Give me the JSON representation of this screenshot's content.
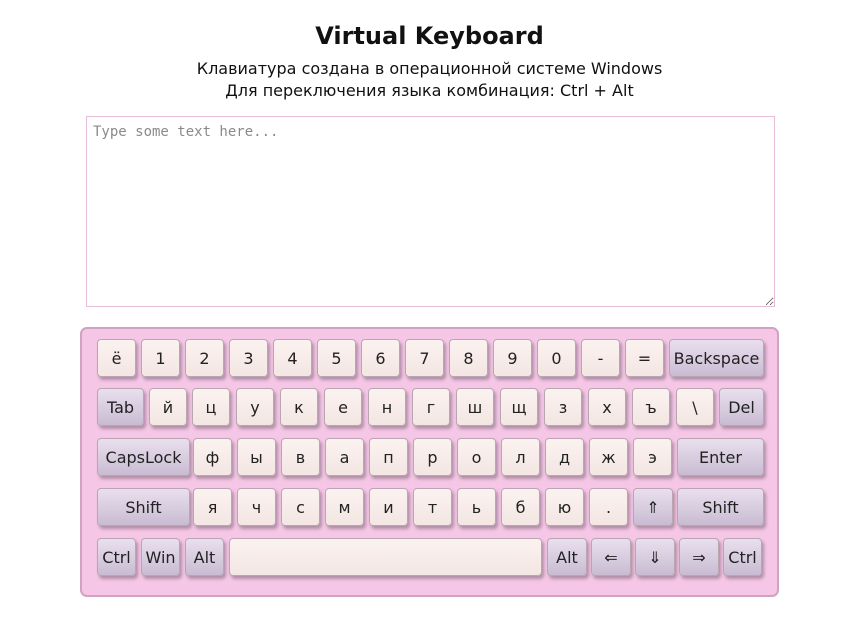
{
  "header": {
    "title": "Virtual Keyboard",
    "line1": "Клавиатура создана в операционной системе Windows",
    "line2": "Для переключения языка комбинация: Ctrl + Alt"
  },
  "textarea": {
    "placeholder": "Type some text here..."
  },
  "keyboard": {
    "rows": [
      [
        {
          "label": "ё",
          "name": "key-yo"
        },
        {
          "label": "1",
          "name": "key-1"
        },
        {
          "label": "2",
          "name": "key-2"
        },
        {
          "label": "3",
          "name": "key-3"
        },
        {
          "label": "4",
          "name": "key-4"
        },
        {
          "label": "5",
          "name": "key-5"
        },
        {
          "label": "6",
          "name": "key-6"
        },
        {
          "label": "7",
          "name": "key-7"
        },
        {
          "label": "8",
          "name": "key-8"
        },
        {
          "label": "9",
          "name": "key-9"
        },
        {
          "label": "0",
          "name": "key-0"
        },
        {
          "label": "-",
          "name": "key-minus"
        },
        {
          "label": "=",
          "name": "key-equals"
        },
        {
          "label": "Backspace",
          "name": "key-backspace",
          "fn": true
        }
      ],
      [
        {
          "label": "Tab",
          "name": "key-tab",
          "fn": true
        },
        {
          "label": "й",
          "name": "key-i-kratkoe"
        },
        {
          "label": "ц",
          "name": "key-ts"
        },
        {
          "label": "у",
          "name": "key-u"
        },
        {
          "label": "к",
          "name": "key-k"
        },
        {
          "label": "е",
          "name": "key-ye"
        },
        {
          "label": "н",
          "name": "key-n"
        },
        {
          "label": "г",
          "name": "key-g"
        },
        {
          "label": "ш",
          "name": "key-sh"
        },
        {
          "label": "щ",
          "name": "key-shch"
        },
        {
          "label": "з",
          "name": "key-z"
        },
        {
          "label": "х",
          "name": "key-kh"
        },
        {
          "label": "ъ",
          "name": "key-hard-sign"
        },
        {
          "label": "\\",
          "name": "key-backslash"
        },
        {
          "label": "Del",
          "name": "key-del",
          "fn": true
        }
      ],
      [
        {
          "label": "CapsLock",
          "name": "key-capslock",
          "fn": true
        },
        {
          "label": "ф",
          "name": "key-f"
        },
        {
          "label": "ы",
          "name": "key-y"
        },
        {
          "label": "в",
          "name": "key-v"
        },
        {
          "label": "а",
          "name": "key-a"
        },
        {
          "label": "п",
          "name": "key-p"
        },
        {
          "label": "р",
          "name": "key-r"
        },
        {
          "label": "о",
          "name": "key-o"
        },
        {
          "label": "л",
          "name": "key-l"
        },
        {
          "label": "д",
          "name": "key-d"
        },
        {
          "label": "ж",
          "name": "key-zh"
        },
        {
          "label": "э",
          "name": "key-e"
        },
        {
          "label": "Enter",
          "name": "key-enter",
          "fn": true
        }
      ],
      [
        {
          "label": "Shift",
          "name": "key-shift-left",
          "fn": true
        },
        {
          "label": "я",
          "name": "key-ya"
        },
        {
          "label": "ч",
          "name": "key-ch"
        },
        {
          "label": "с",
          "name": "key-s"
        },
        {
          "label": "м",
          "name": "key-m"
        },
        {
          "label": "и",
          "name": "key-i"
        },
        {
          "label": "т",
          "name": "key-t"
        },
        {
          "label": "ь",
          "name": "key-soft-sign"
        },
        {
          "label": "б",
          "name": "key-b"
        },
        {
          "label": "ю",
          "name": "key-yu"
        },
        {
          "label": ".",
          "name": "key-period"
        },
        {
          "label": "⇑",
          "name": "key-arrow-up",
          "fn": true
        },
        {
          "label": "Shift",
          "name": "key-shift-right",
          "fn": true
        }
      ],
      [
        {
          "label": "Ctrl",
          "name": "key-ctrl-left",
          "fn": true
        },
        {
          "label": "Win",
          "name": "key-win",
          "fn": true
        },
        {
          "label": "Alt",
          "name": "key-alt-left",
          "fn": true
        },
        {
          "label": "",
          "name": "key-space"
        },
        {
          "label": "Alt",
          "name": "key-alt-right",
          "fn": true
        },
        {
          "label": "⇐",
          "name": "key-arrow-left",
          "fn": true
        },
        {
          "label": "⇓",
          "name": "key-arrow-down",
          "fn": true
        },
        {
          "label": "⇒",
          "name": "key-arrow-right",
          "fn": true
        },
        {
          "label": "Ctrl",
          "name": "key-ctrl-right",
          "fn": true
        }
      ]
    ]
  }
}
